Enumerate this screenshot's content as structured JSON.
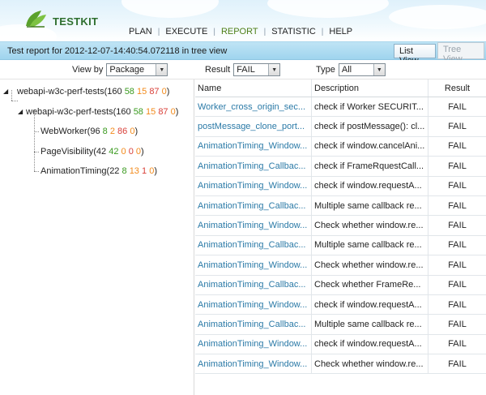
{
  "header": {
    "logo_text": "TESTKIT",
    "nav": [
      "PLAN",
      "EXECUTE",
      "REPORT",
      "STATISTIC",
      "HELP"
    ],
    "active_nav": "REPORT"
  },
  "titlebar": {
    "title": "Test report for 2012-12-07-14:40:54.072118 in tree view",
    "list_view": "List View",
    "tree_view": "Tree View"
  },
  "filters": {
    "view_by_label": "View by",
    "view_by_value": "Package",
    "result_label": "Result",
    "result_value": "FAIL",
    "type_label": "Type",
    "type_value": "All"
  },
  "tree": [
    {
      "label": "webapi-w3c-perf-tests(",
      "counts": [
        "160",
        "58",
        "15",
        "87",
        "0"
      ]
    },
    {
      "label": "webapi-w3c-perf-tests(",
      "counts": [
        "160",
        "58",
        "15",
        "87",
        "0"
      ]
    },
    {
      "label": "WebWorker(",
      "counts": [
        "96",
        "8",
        "2",
        "86",
        "0"
      ]
    },
    {
      "label": "PageVisibility(",
      "counts": [
        "42",
        "42",
        "0",
        "0",
        "0"
      ]
    },
    {
      "label": "AnimationTiming(",
      "counts": [
        "22",
        "8",
        "13",
        "1",
        "0"
      ]
    }
  ],
  "table": {
    "headers": {
      "name": "Name",
      "description": "Description",
      "result": "Result"
    },
    "rows": [
      {
        "name": "Worker_cross_origin_sec...",
        "description": "check if Worker SECURIT...",
        "result": "FAIL"
      },
      {
        "name": "postMessage_clone_port...",
        "description": "check if postMessage(): cl...",
        "result": "FAIL"
      },
      {
        "name": "AnimationTiming_Window...",
        "description": "check if window.cancelAni...",
        "result": "FAIL"
      },
      {
        "name": "AnimationTiming_Callbac...",
        "description": "check if FrameRquestCall...",
        "result": "FAIL"
      },
      {
        "name": "AnimationTiming_Window...",
        "description": "check if window.requestA...",
        "result": "FAIL"
      },
      {
        "name": "AnimationTiming_Callbac...",
        "description": "Multiple same callback re...",
        "result": "FAIL"
      },
      {
        "name": "AnimationTiming_Window...",
        "description": "Check whether window.re...",
        "result": "FAIL"
      },
      {
        "name": "AnimationTiming_Callbac...",
        "description": "Multiple same callback re...",
        "result": "FAIL"
      },
      {
        "name": "AnimationTiming_Window...",
        "description": "Check whether window.re...",
        "result": "FAIL"
      },
      {
        "name": "AnimationTiming_Callbac...",
        "description": "Check whether FrameRe...",
        "result": "FAIL"
      },
      {
        "name": "AnimationTiming_Window...",
        "description": "check if window.requestA...",
        "result": "FAIL"
      },
      {
        "name": "AnimationTiming_Callbac...",
        "description": "Multiple same callback re...",
        "result": "FAIL"
      },
      {
        "name": "AnimationTiming_Window...",
        "description": "check if window.requestA...",
        "result": "FAIL"
      },
      {
        "name": "AnimationTiming_Window...",
        "description": "Check whether window.re...",
        "result": "FAIL"
      }
    ]
  },
  "colors": {
    "link": "#2b7aa7",
    "titlebar": "#aedcf1",
    "pass": "#3a9a1f",
    "fail": "#d9413a",
    "block": "#f28a1b"
  }
}
